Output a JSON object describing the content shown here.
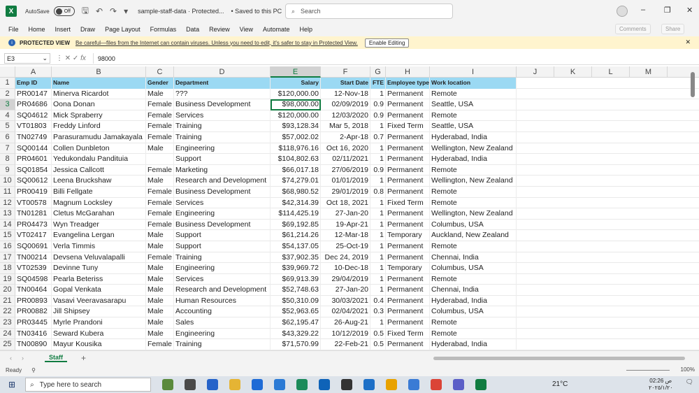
{
  "title": {
    "autosave_label": "AutoSave",
    "autosave_state": "Off",
    "doc_name": "sample-staff-data  ·  Protected...",
    "saved_status": "• Saved to this PC",
    "search_placeholder": "Search"
  },
  "menu": [
    "File",
    "Home",
    "Insert",
    "Draw",
    "Page Layout",
    "Formulas",
    "Data",
    "Review",
    "View",
    "Automate",
    "Help"
  ],
  "right_buttons": {
    "comments": "Comments",
    "share": "Share"
  },
  "protected_view": {
    "title": "PROTECTED VIEW",
    "message": "Be careful—files from the Internet can contain viruses. Unless you need to edit, it's safer to stay in Protected View.",
    "button": "Enable Editing"
  },
  "formula_bar": {
    "cell_ref": "E3",
    "fx": "fx",
    "value": "98000"
  },
  "columns": [
    "A",
    "B",
    "C",
    "D",
    "E",
    "F",
    "G",
    "H",
    "I",
    "J",
    "K",
    "L",
    "M"
  ],
  "active_column": "E",
  "active_row": 3,
  "header_row": [
    "Emp ID",
    "Name",
    "Gender",
    "Department",
    "Salary",
    "Start Date",
    "FTE",
    "Employee type",
    "Work location"
  ],
  "rows": [
    [
      "PR00147",
      "Minerva Ricardot",
      "Male",
      "???",
      "$120,000.00",
      "12-Nov-18",
      "1",
      "Permanent",
      "Remote"
    ],
    [
      "PR04686",
      "Oona Donan",
      "Female",
      "Business Development",
      "$98,000.00",
      "02/09/2019",
      "0.9",
      "Permanent",
      "Seattle, USA"
    ],
    [
      "SQ04612",
      "Mick Spraberry",
      "Female",
      "Services",
      "$120,000.00",
      "12/03/2020",
      "0.9",
      "Permanent",
      "Remote"
    ],
    [
      "VT01803",
      "Freddy Linford",
      "Female",
      "Training",
      "$93,128.34",
      "Mar 5, 2018",
      "1",
      "Fixed Term",
      "Seattle, USA"
    ],
    [
      "TN02749",
      "Parasuramudu Jamakayala",
      "Female",
      "Training",
      "$57,002.02",
      "2-Apr-18",
      "0.7",
      "Permanent",
      "Hyderabad, India"
    ],
    [
      "SQ00144",
      "Collen Dunbleton",
      "Male",
      "Engineering",
      "$118,976.16",
      "Oct 16, 2020",
      "1",
      "Permanent",
      "Wellington, New Zealand"
    ],
    [
      "PR04601",
      "Yedukondalu Pandituia",
      "",
      "Support",
      "$104,802.63",
      "02/11/2021",
      "1",
      "Permanent",
      "Hyderabad, India"
    ],
    [
      "SQ01854",
      "Jessica Callcott",
      "Female",
      "Marketing",
      "$66,017.18",
      "27/06/2019",
      "0.9",
      "Permanent",
      "Remote"
    ],
    [
      "SQ00612",
      "Leena Bruckshaw",
      "Male",
      "Research and Development",
      "$74,279.01",
      "01/01/2019",
      "1",
      "Permanent",
      "Wellington, New Zealand"
    ],
    [
      "PR00419",
      "Billi Fellgate",
      "Female",
      "Business Development",
      "$68,980.52",
      "29/01/2019",
      "0.8",
      "Permanent",
      "Remote"
    ],
    [
      "VT00578",
      "Magnum Locksley",
      "Female",
      "Services",
      "$42,314.39",
      "Oct 18, 2021",
      "1",
      "Fixed Term",
      "Remote"
    ],
    [
      "TN01281",
      "Cletus McGarahan",
      "Female",
      "Engineering",
      "$114,425.19",
      "27-Jan-20",
      "1",
      "Permanent",
      "Wellington, New Zealand"
    ],
    [
      "PR04473",
      "Wyn Treadger",
      "Female",
      "Business Development",
      "$69,192.85",
      "19-Apr-21",
      "1",
      "Permanent",
      "Columbus, USA"
    ],
    [
      "VT02417",
      "Evangelina Lergan",
      "Male",
      "Support",
      "$61,214.26",
      "12-Mar-18",
      "1",
      "Temporary",
      "Auckland, New Zealand"
    ],
    [
      "SQ00691",
      "Verla Timmis",
      "Male",
      "Support",
      "$54,137.05",
      "25-Oct-19",
      "1",
      "Permanent",
      "Remote"
    ],
    [
      "TN00214",
      "Devsena Veluvalapalli",
      "Female",
      "Training",
      "$37,902.35",
      "Dec 24, 2019",
      "1",
      "Permanent",
      "Chennai, India"
    ],
    [
      "VT02539",
      "Devinne Tuny",
      "Male",
      "Engineering",
      "$39,969.72",
      "10-Dec-18",
      "1",
      "Temporary",
      "Columbus, USA"
    ],
    [
      "SQ04598",
      "Pearla  Beteriss",
      "Male",
      "Services",
      "$69,913.39",
      "29/04/2019",
      "1",
      "Permanent",
      "Remote"
    ],
    [
      "TN00464",
      "Gopal Venkata",
      "Male",
      "Research and Development",
      "$52,748.63",
      "27-Jan-20",
      "1",
      "Permanent",
      "Chennai, India"
    ],
    [
      "PR00893",
      "Vasavi Veeravasarapu",
      "Male",
      "Human Resources",
      "$50,310.09",
      "30/03/2021",
      "0.4",
      "Permanent",
      "Hyderabad, India"
    ],
    [
      "PR00882",
      "Jill Shipsey",
      "Male",
      "Accounting",
      "$52,963.65",
      "02/04/2021",
      "0.3",
      "Permanent",
      "Columbus, USA"
    ],
    [
      "PR03445",
      "Myrle Prandoni",
      "Male",
      "Sales",
      "$62,195.47",
      "26-Aug-21",
      "1",
      "Permanent",
      "Remote"
    ],
    [
      "TN03416",
      "Seward Kubera",
      "Male",
      "Engineering",
      "$43,329.22",
      "10/12/2019",
      "0.5",
      "Fixed Term",
      "Remote"
    ],
    [
      "TN00890",
      "Mayur Kousika",
      "Female",
      "Training",
      "$71,570.99",
      "22-Feb-21",
      "0.5",
      "Permanent",
      "Hyderabad, India"
    ]
  ],
  "sheet_tabs": {
    "active": "Staff"
  },
  "status": {
    "ready": "Ready",
    "zoom": "100%"
  },
  "taskbar": {
    "search_placeholder": "Type here to search",
    "weather": "21°C",
    "time": "02:26 ص",
    "date": "٢٠٢٥/١/٢٠"
  },
  "colors": {
    "header_fill": "#9bd9f3",
    "excel_green": "#107c41",
    "protected_bg": "#fff4ce"
  }
}
